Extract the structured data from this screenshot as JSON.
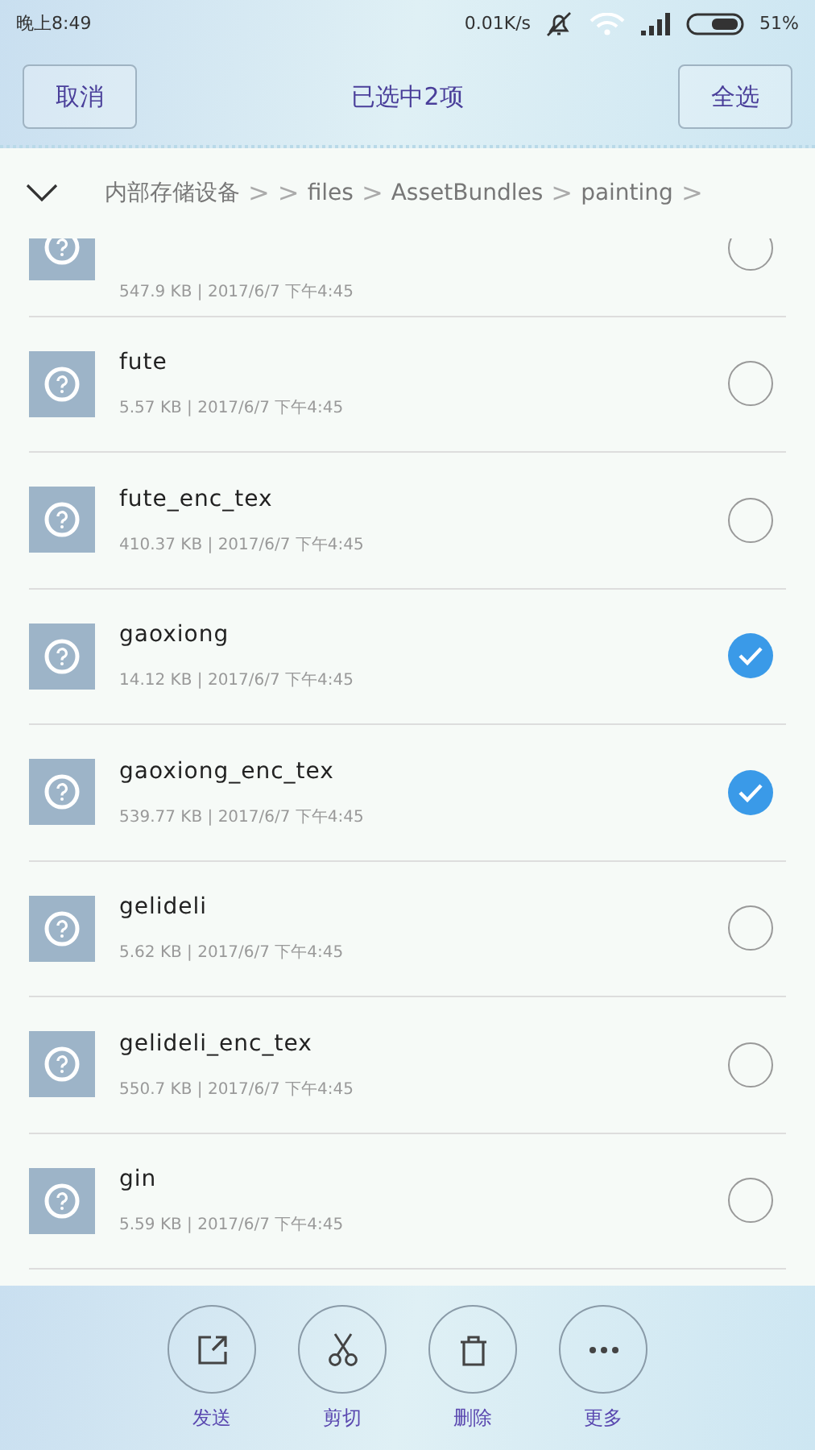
{
  "status_bar": {
    "time": "晚上8:49",
    "speed": "0.01K/s",
    "battery": "51%"
  },
  "header": {
    "cancel": "取消",
    "title": "已选中2项",
    "select_all": "全选"
  },
  "breadcrumb": [
    {
      "kind": "folder",
      "text": "内部存储设备"
    },
    {
      "kind": "sep",
      "text": ">"
    },
    {
      "kind": "sep",
      "text": ">"
    },
    {
      "kind": "folder",
      "text": "files"
    },
    {
      "kind": "sep",
      "text": ">"
    },
    {
      "kind": "folder",
      "text": "AssetBundles"
    },
    {
      "kind": "sep",
      "text": ">"
    },
    {
      "kind": "folder",
      "text": "painting"
    },
    {
      "kind": "sep",
      "text": ">"
    }
  ],
  "files": [
    {
      "kind": "partial",
      "meta": "547.9 KB | 2017/6/7 下午4:45",
      "selected": false
    },
    {
      "kind": "full",
      "name": "fute",
      "meta": "5.57 KB | 2017/6/7 下午4:45",
      "selected": false
    },
    {
      "kind": "full",
      "name": "fute_enc_tex",
      "meta": "410.37 KB | 2017/6/7 下午4:45",
      "selected": false
    },
    {
      "kind": "full",
      "name": "gaoxiong",
      "meta": "14.12 KB | 2017/6/7 下午4:45",
      "selected": true
    },
    {
      "kind": "full",
      "name": "gaoxiong_enc_tex",
      "meta": "539.77 KB | 2017/6/7 下午4:45",
      "selected": true
    },
    {
      "kind": "full",
      "name": "gelideli",
      "meta": "5.62 KB | 2017/6/7 下午4:45",
      "selected": false
    },
    {
      "kind": "full",
      "name": "gelideli_enc_tex",
      "meta": "550.7 KB | 2017/6/7 下午4:45",
      "selected": false
    },
    {
      "kind": "full",
      "name": "gin",
      "meta": "5.59 KB | 2017/6/7 下午4:45",
      "selected": false
    }
  ],
  "actions": [
    {
      "kind": "send",
      "label": "发送"
    },
    {
      "kind": "cut",
      "label": "剪切"
    },
    {
      "kind": "delete",
      "label": "删除"
    },
    {
      "kind": "more",
      "label": "更多"
    }
  ]
}
